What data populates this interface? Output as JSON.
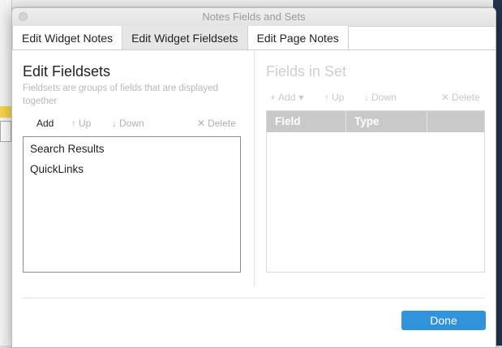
{
  "window": {
    "title": "Notes Fields and Sets"
  },
  "tabs": [
    {
      "label": "Edit Widget Notes",
      "active": false
    },
    {
      "label": "Edit Widget Fieldsets",
      "active": true
    },
    {
      "label": "Edit Page Notes",
      "active": false
    }
  ],
  "left": {
    "title": "Edit Fieldsets",
    "description": "Fieldsets are groups of fields that are displayed together",
    "toolbar": {
      "add": "Add",
      "up": "Up",
      "down": "Down",
      "delete": "Delete"
    },
    "items": [
      "Search Results",
      "QuickLinks"
    ]
  },
  "right": {
    "title": "Fields in Set",
    "toolbar": {
      "add": "Add",
      "up": "Up",
      "down": "Down",
      "delete": "Delete"
    },
    "columns": [
      "Field",
      "Type",
      ""
    ]
  },
  "footer": {
    "done": "Done"
  },
  "colors": {
    "accent": "#3193da",
    "header": "#c9c9c9"
  },
  "icons": {
    "plus": "+",
    "caret": "▾",
    "up": "↑",
    "down": "↓",
    "delete": "✕"
  }
}
